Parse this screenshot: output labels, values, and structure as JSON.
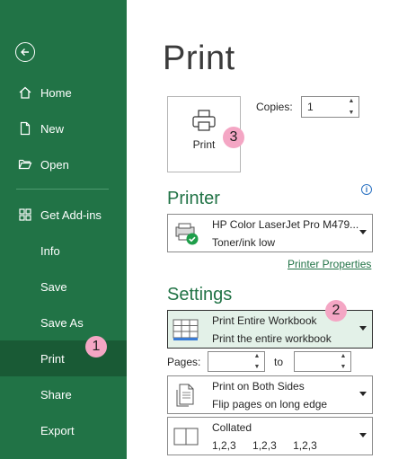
{
  "sidebar": {
    "back_label": "Back",
    "items": [
      {
        "label": "Home",
        "icon": "home-icon"
      },
      {
        "label": "New",
        "icon": "new-file-icon"
      },
      {
        "label": "Open",
        "icon": "folder-open-icon"
      },
      {
        "label": "Get Add-ins",
        "icon": "grid-icon"
      },
      {
        "label": "Info"
      },
      {
        "label": "Save"
      },
      {
        "label": "Save As"
      },
      {
        "label": "Print",
        "selected": true
      },
      {
        "label": "Share"
      },
      {
        "label": "Export"
      }
    ]
  },
  "badges": {
    "b1": "1",
    "b2": "2",
    "b3": "3"
  },
  "main": {
    "title": "Print",
    "print_button_label": "Print",
    "copies_label": "Copies:",
    "copies_value": "1",
    "printer": {
      "section_title": "Printer",
      "name": "HP Color LaserJet Pro M479...",
      "status": "Toner/ink low",
      "properties_link": "Printer Properties"
    },
    "settings": {
      "section_title": "Settings",
      "scope_title": "Print Entire Workbook",
      "scope_desc": "Print the entire workbook",
      "pages_label": "Pages:",
      "pages_from": "",
      "to_label": "to",
      "pages_to": "",
      "sides_title": "Print on Both Sides",
      "sides_desc": "Flip pages on long edge",
      "collate_title": "Collated",
      "collate_order": [
        "1,2,3",
        "1,2,3",
        "1,2,3"
      ]
    }
  },
  "colors": {
    "sidebar": "#217346",
    "selected": "#195a35",
    "accent": "#217346",
    "badge": "#f4a6c4"
  }
}
